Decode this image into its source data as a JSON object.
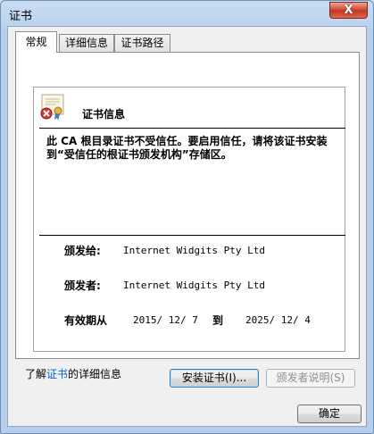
{
  "window": {
    "title": "证书",
    "close_glyph": "X"
  },
  "tabs": [
    {
      "label": "常规",
      "active": true
    },
    {
      "label": "详细信息",
      "active": false
    },
    {
      "label": "证书路径",
      "active": false
    }
  ],
  "cert": {
    "title": "证书信息",
    "warning": "此 CA 根目录证书不受信任。要启用信任，请将该证书安装到“受信任的根证书颁发机构”存储区。",
    "issued_to_label": "颁发给:",
    "issued_to_value": "Internet Widgits Pty Ltd",
    "issued_by_label": "颁发者:",
    "issued_by_value": "Internet Widgits Pty Ltd",
    "validity_label": "有效期从",
    "valid_from": "2015/ 12/ 7",
    "to_label": "到",
    "valid_to": "2025/ 12/ 4"
  },
  "buttons": {
    "install": "安装证书(I)...",
    "issuer_statement": "颁发者说明(S)",
    "ok": "确定"
  },
  "learn_more": {
    "prefix": "了解",
    "link": "证书",
    "suffix": "的详细信息"
  },
  "colors": {
    "link": "#0066cc",
    "close": "#c43420"
  },
  "icons": [
    "certificate-icon",
    "error-icon",
    "close-icon"
  ]
}
